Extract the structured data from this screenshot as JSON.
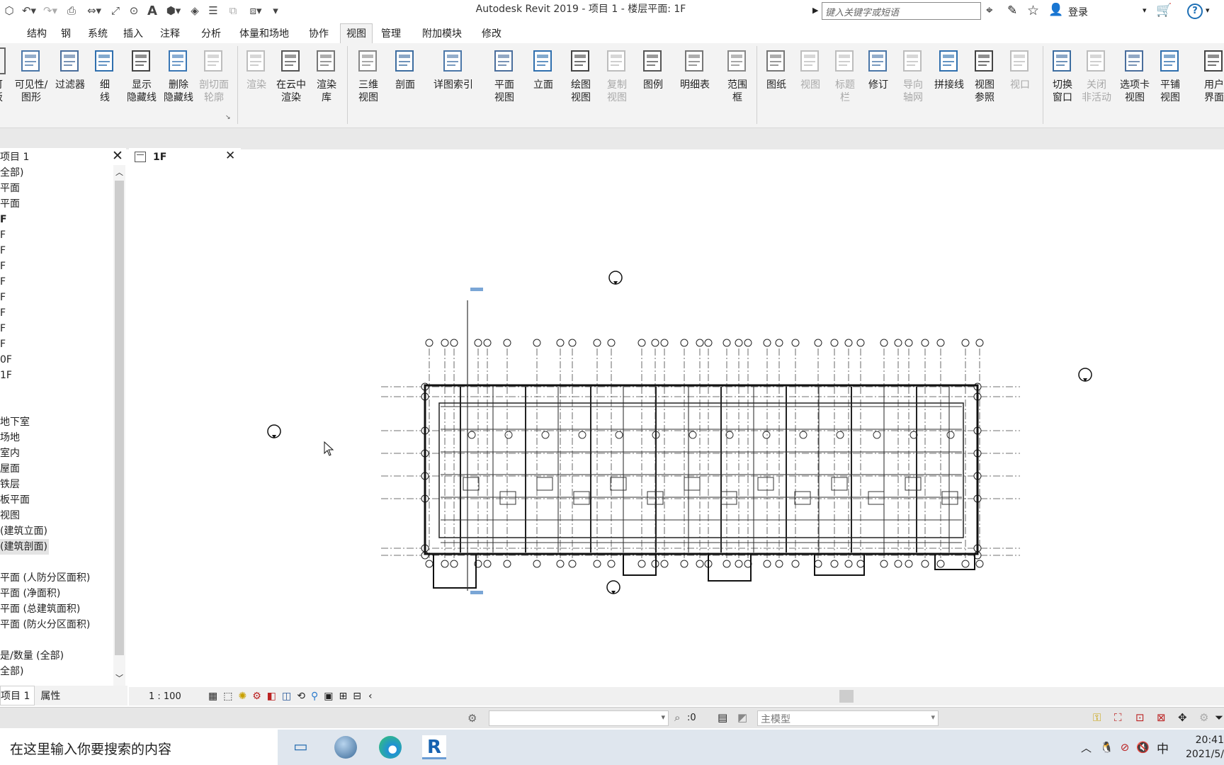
{
  "window": {
    "title": "Autodesk Revit 2019 - 项目 1 - 楼层平面: 1F"
  },
  "search": {
    "placeholder": "键入关键字或短语"
  },
  "account": {
    "login": "登录",
    "help": "?"
  },
  "tabs": [
    "结构",
    "钢",
    "系统",
    "插入",
    "注释",
    "分析",
    "体量和场地",
    "协作",
    "视图",
    "管理",
    "附加模块",
    "修改"
  ],
  "ribbon": {
    "graphics": [
      {
        "l1": "可见性/",
        "l2": "图形",
        "dis": false
      },
      {
        "l1": "过滤器",
        "l2": "",
        "dis": false
      },
      {
        "l1": "细",
        "l2": "线",
        "dis": false
      },
      {
        "l1": "显示",
        "l2": "隐藏线",
        "dis": false
      },
      {
        "l1": "删除",
        "l2": "隐藏线",
        "dis": false
      },
      {
        "l1": "剖切面",
        "l2": "轮廓",
        "dis": true
      }
    ],
    "presentation": [
      {
        "l1": "渲染",
        "l2": "",
        "dis": true
      },
      {
        "l1": "在云中",
        "l2": "渲染",
        "dis": false
      },
      {
        "l1": "渲染",
        "l2": "库",
        "dis": false
      }
    ],
    "create": [
      {
        "l1": "三维",
        "l2": "视图",
        "dis": false
      },
      {
        "l1": "剖面",
        "l2": "",
        "dis": false
      },
      {
        "l1": "详图索引",
        "l2": "",
        "dis": false
      },
      {
        "l1": "平面",
        "l2": "视图",
        "dis": false
      },
      {
        "l1": "立面",
        "l2": "",
        "dis": false
      },
      {
        "l1": "绘图",
        "l2": "视图",
        "dis": false
      },
      {
        "l1": "复制",
        "l2": "视图",
        "dis": true
      },
      {
        "l1": "图例",
        "l2": "",
        "dis": false
      },
      {
        "l1": "明细表",
        "l2": "",
        "dis": false
      },
      {
        "l1": "范围",
        "l2": "框",
        "dis": false
      }
    ],
    "sheet": [
      {
        "l1": "图纸",
        "l2": "",
        "dis": false
      },
      {
        "l1": "视图",
        "l2": "",
        "dis": true
      },
      {
        "l1": "标题",
        "l2": "栏",
        "dis": true
      },
      {
        "l1": "修订",
        "l2": "",
        "dis": false
      },
      {
        "l1": "导向",
        "l2": "轴网",
        "dis": true
      },
      {
        "l1": "拼接线",
        "l2": "",
        "dis": false
      },
      {
        "l1": "视图",
        "l2": "参照",
        "dis": false
      },
      {
        "l1": "视口",
        "l2": "",
        "dis": true
      }
    ],
    "windows": [
      {
        "l1": "切换",
        "l2": "窗口",
        "dis": false
      },
      {
        "l1": "关闭",
        "l2": "非活动",
        "dis": true
      },
      {
        "l1": "选项卡",
        "l2": "视图",
        "dis": false
      },
      {
        "l1": "平铺",
        "l2": "视图",
        "dis": false
      },
      {
        "l1": "用户",
        "l2": "界面",
        "dis": false
      }
    ],
    "left_partial": {
      "l1": "可",
      "l2": "板"
    }
  },
  "browser": {
    "title": "项目 1",
    "items": [
      "全部)",
      "平面",
      "平面",
      "F",
      "F",
      "F",
      "F",
      "F",
      "F",
      "F",
      "F",
      "F",
      "0F",
      "1F",
      "",
      "",
      "地下室",
      "场地",
      "室内",
      "屋面",
      "铁层",
      "板平面",
      "视图",
      "(建筑立面)",
      "(建筑剖面)",
      "",
      "平面 (人防分区面积)",
      "平面 (净面积)",
      "平面 (总建筑面积)",
      "平面 (防火分区面积)",
      "",
      "是/数量 (全部)",
      "全部)"
    ],
    "selected_index": 24,
    "tabs": {
      "project": "项目 1",
      "properties": "属性"
    }
  },
  "view": {
    "tab": "1F",
    "scale": "1 : 100"
  },
  "status": {
    "workset_count": ":0",
    "model": "主模型"
  },
  "taskbar": {
    "search": "在这里输入你要搜索的内容",
    "ime": "中",
    "time": "20:41",
    "date": "2021/5/"
  }
}
